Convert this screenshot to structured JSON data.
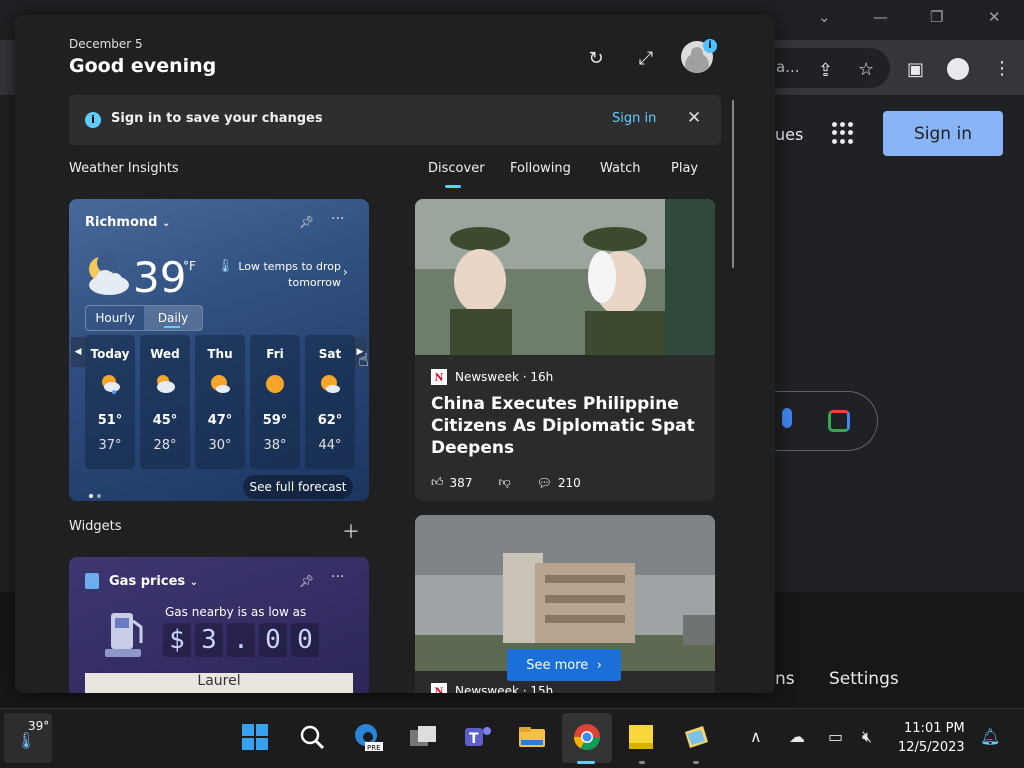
{
  "browser": {
    "omnibox_text": "a...",
    "menu_signin_fragment": "ues",
    "signin_button": "Sign in",
    "footer_link": "ns",
    "footer_settings": "Settings"
  },
  "header": {
    "date": "December 5",
    "greeting": "Good evening",
    "avatar_badge": "i"
  },
  "banner": {
    "message": "Sign in to save your changes",
    "link": "Sign in"
  },
  "sections": {
    "weather_insights": "Weather Insights",
    "widgets": "Widgets"
  },
  "tabs": [
    "Discover",
    "Following",
    "Watch",
    "Play"
  ],
  "weather": {
    "location": "Richmond",
    "temp": "39",
    "unit": "°F",
    "alert": "Low temps to drop tomorrow",
    "toggle": [
      "Hourly",
      "Daily"
    ],
    "days": [
      {
        "name": "Today",
        "hi": "51°",
        "lo": "37°",
        "icon": "partly-cloudy-rain-icon"
      },
      {
        "name": "Wed",
        "hi": "45°",
        "lo": "28°",
        "icon": "partly-cloudy-icon"
      },
      {
        "name": "Thu",
        "hi": "47°",
        "lo": "30°",
        "icon": "partly-sunny-icon"
      },
      {
        "name": "Fri",
        "hi": "59°",
        "lo": "38°",
        "icon": "sunny-icon"
      },
      {
        "name": "Sat",
        "hi": "62°",
        "lo": "44°",
        "icon": "partly-sunny-icon"
      }
    ],
    "full_forecast": "See full forecast"
  },
  "gas": {
    "title": "Gas prices",
    "subtitle": "Gas nearby is as low as",
    "digits": [
      "$",
      "3",
      ".",
      "0",
      "0"
    ],
    "map_label": "Laurel"
  },
  "news": [
    {
      "source": "Newsweek · 16h",
      "headline": "China Executes Philippine Citizens As Diplomatic Spat Deepens",
      "likes": "387",
      "comments": "210"
    },
    {
      "see_more": "See more",
      "source": "Newsweek · 15h"
    }
  ],
  "taskbar": {
    "weather_temp": "39°",
    "time": "11:01 PM",
    "date": "12/5/2023"
  }
}
